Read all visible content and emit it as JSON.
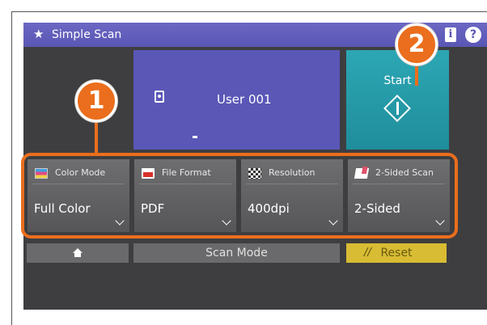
{
  "titlebar": {
    "title": "Simple Scan",
    "star_icon": "star-icon",
    "info_icon": "i",
    "help_icon": "?"
  },
  "user_tile": {
    "name": "User 001",
    "cursor": "-"
  },
  "start_tile": {
    "label": "Start"
  },
  "functions": [
    {
      "label": "Color Mode",
      "value": "Full Color",
      "icon": "color-mode-icon"
    },
    {
      "label": "File Format",
      "value": "PDF",
      "icon": "pdf-icon"
    },
    {
      "label": "Resolution",
      "value": "400dpi",
      "icon": "resolution-icon"
    },
    {
      "label": "2-Sided Scan",
      "value": "2-Sided",
      "icon": "two-sided-icon"
    }
  ],
  "bottom": {
    "home_icon": "home-icon",
    "scan_mode_label": "Scan Mode",
    "reset_label": "Reset"
  },
  "callouts": {
    "one": "1",
    "two": "2"
  },
  "colors": {
    "title_bar": "#5a56b4",
    "user_tile": "#5a57b7",
    "start_tile": "#2da7b4",
    "highlight": "#ea6e1d",
    "reset": "#d8bc33",
    "screen_bg": "#3e3e40"
  }
}
